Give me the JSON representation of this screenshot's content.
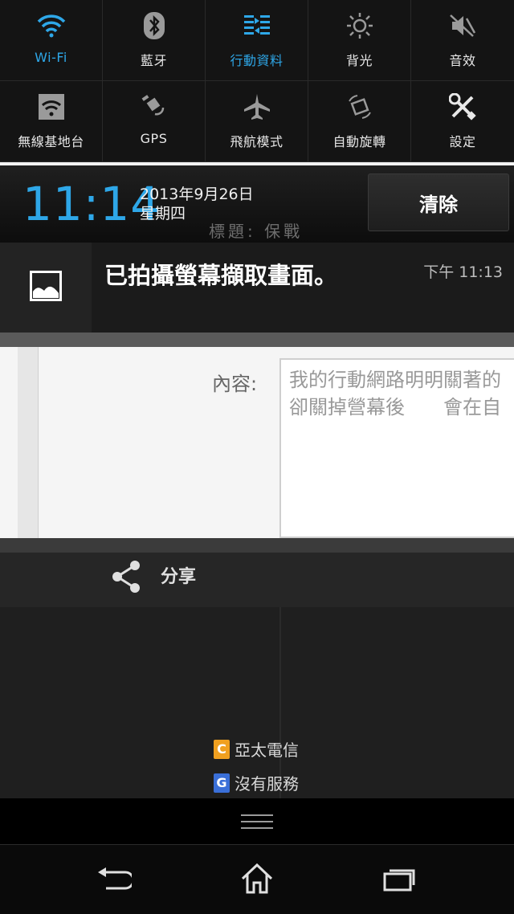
{
  "quick_settings": {
    "row1": [
      {
        "label": "Wi-Fi",
        "icon": "wifi-icon",
        "active": true
      },
      {
        "label": "藍牙",
        "icon": "bluetooth-icon",
        "active": false
      },
      {
        "label": "行動資料",
        "icon": "mobile-data-icon",
        "active": true
      },
      {
        "label": "背光",
        "icon": "brightness-icon",
        "active": false
      },
      {
        "label": "音效",
        "icon": "sound-off-icon",
        "active": false
      }
    ],
    "row2": [
      {
        "label": "無線基地台",
        "icon": "hotspot-icon",
        "active": false
      },
      {
        "label": "GPS",
        "icon": "gps-icon",
        "active": false
      },
      {
        "label": "飛航模式",
        "icon": "airplane-icon",
        "active": false
      },
      {
        "label": "自動旋轉",
        "icon": "rotate-icon",
        "active": false
      },
      {
        "label": "設定",
        "icon": "settings-icon",
        "active": false
      }
    ]
  },
  "header": {
    "time": "11:14",
    "date": "2013年9月26日",
    "weekday": "星期四",
    "clear_label": "清除",
    "ghost_text": "標題: 保戰"
  },
  "notification": {
    "title": "已拍攝螢幕擷取畫面。",
    "time": "下午 11:13",
    "icon": "image-icon"
  },
  "preview": {
    "label": "內容:",
    "line1": "我的行動網路明明關著的",
    "line2": "卻關掉營幕後　　會在自"
  },
  "share": {
    "label": "分享",
    "icon": "share-icon"
  },
  "carriers": [
    {
      "badge": "C",
      "name": "亞太電信",
      "color": "#f0a020"
    },
    {
      "badge": "G",
      "name": "沒有服務",
      "color": "#3a6fd8"
    }
  ],
  "colors": {
    "accent": "#2ea7e8"
  }
}
